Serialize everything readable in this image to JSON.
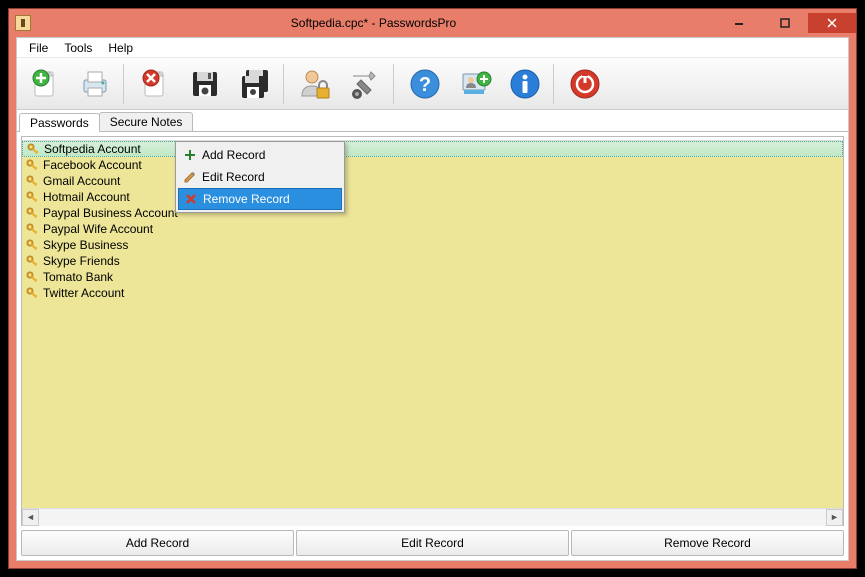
{
  "title": "Softpedia.cpc* - PasswordsPro",
  "menubar": [
    "File",
    "Tools",
    "Help"
  ],
  "tabs": [
    {
      "label": "Passwords",
      "active": true
    },
    {
      "label": "Secure Notes",
      "active": false
    }
  ],
  "records": [
    {
      "label": "Softpedia Account",
      "selected": true
    },
    {
      "label": "Facebook Account",
      "selected": false
    },
    {
      "label": "Gmail Account",
      "selected": false
    },
    {
      "label": "Hotmail Account",
      "selected": false
    },
    {
      "label": "Paypal Business Account",
      "selected": false
    },
    {
      "label": "Paypal Wife Account",
      "selected": false
    },
    {
      "label": "Skype Business",
      "selected": false
    },
    {
      "label": "Skype Friends",
      "selected": false
    },
    {
      "label": "Tomato Bank",
      "selected": false
    },
    {
      "label": "Twitter Account",
      "selected": false
    }
  ],
  "context_menu": [
    {
      "label": "Add Record",
      "icon": "plus",
      "highlight": false
    },
    {
      "label": "Edit Record",
      "icon": "pencil",
      "highlight": false
    },
    {
      "label": "Remove Record",
      "icon": "x",
      "highlight": true
    }
  ],
  "bottom_buttons": [
    "Add Record",
    "Edit Record",
    "Remove Record"
  ],
  "toolbar_icons": [
    "new-doc",
    "print",
    "delete-doc",
    "save",
    "save-all",
    "user-lock",
    "settings",
    "help",
    "user-add",
    "info",
    "power"
  ]
}
